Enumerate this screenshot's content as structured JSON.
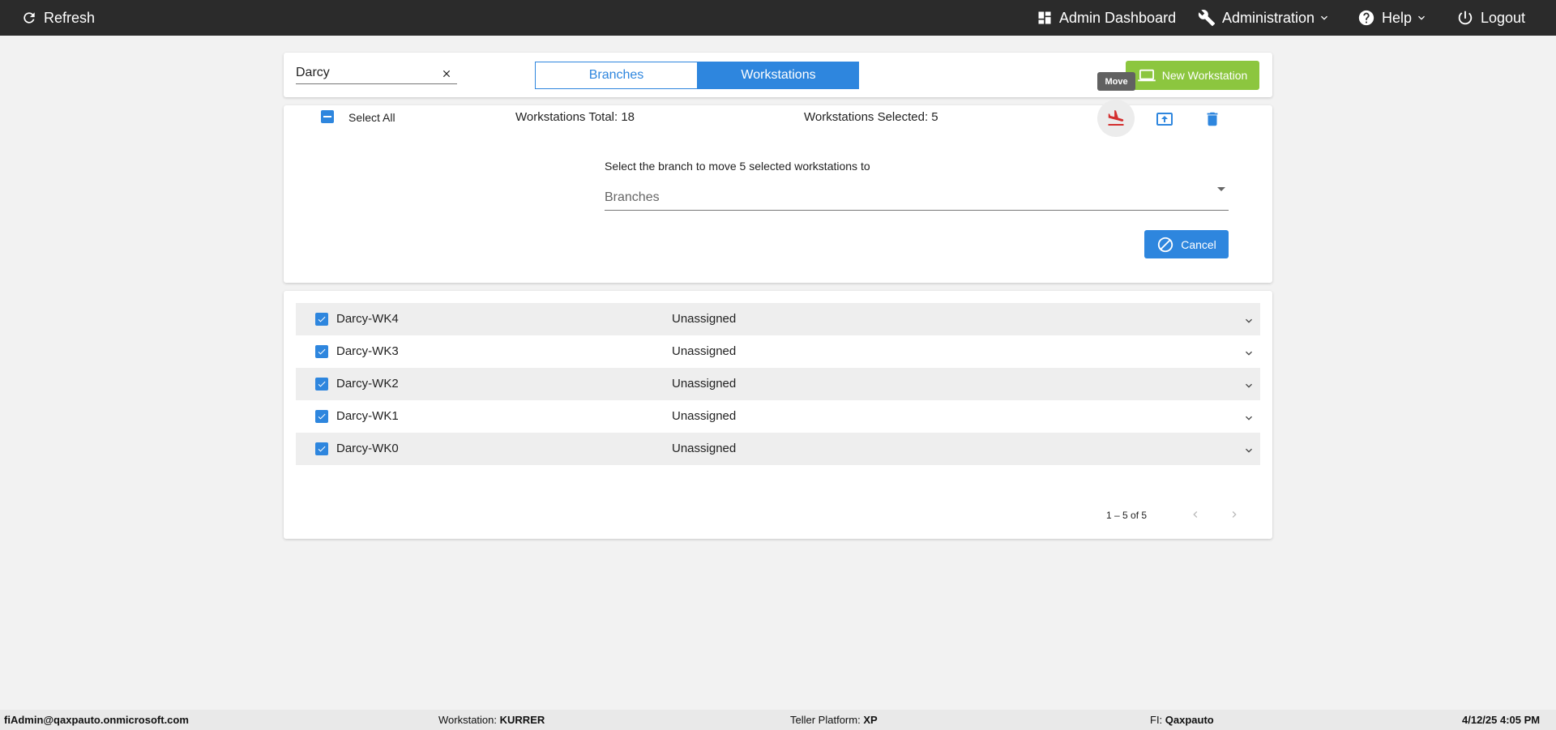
{
  "topbar": {
    "refresh": "Refresh",
    "admin_dashboard": "Admin Dashboard",
    "administration": "Administration",
    "help": "Help",
    "logout": "Logout"
  },
  "search": {
    "value": "Darcy"
  },
  "tabs": {
    "branches": "Branches",
    "workstations": "Workstations",
    "active": "Workstations"
  },
  "new_workstation_label": "New Workstation",
  "tooltip": "Move",
  "selection": {
    "select_all": "Select All",
    "total": "Workstations Total: 18",
    "selected": "Workstations Selected: 5"
  },
  "move_panel": {
    "prompt": "Select the branch to move 5 selected workstations to",
    "placeholder": "Branches",
    "cancel": "Cancel"
  },
  "workstations": [
    {
      "name": "Darcy-WK4",
      "status": "Unassigned",
      "checked": true
    },
    {
      "name": "Darcy-WK3",
      "status": "Unassigned",
      "checked": true
    },
    {
      "name": "Darcy-WK2",
      "status": "Unassigned",
      "checked": true
    },
    {
      "name": "Darcy-WK1",
      "status": "Unassigned",
      "checked": true
    },
    {
      "name": "Darcy-WK0",
      "status": "Unassigned",
      "checked": true
    }
  ],
  "pagination": {
    "range": "1 – 5 of 5"
  },
  "statusbar": {
    "user": "fiAdmin@qaxpauto.onmicrosoft.com",
    "workstation_label": "Workstation:",
    "workstation_value": "KURRER",
    "platform_label": "Teller Platform:",
    "platform_value": "XP",
    "fi_label": "FI:",
    "fi_value": "Qaxpauto",
    "datetime": "4/12/25 4:05 PM"
  },
  "colors": {
    "accent": "#2e86de",
    "new_button": "#8cc63f",
    "move_icon": "#d32f2f",
    "topbar": "#2b2b2b"
  }
}
